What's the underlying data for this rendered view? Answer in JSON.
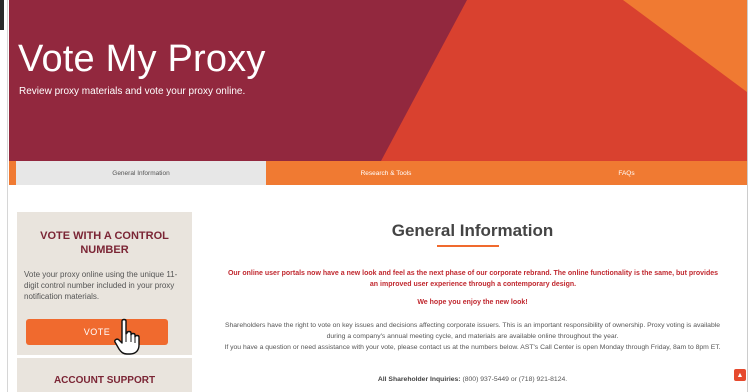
{
  "hero": {
    "title": "Vote My Proxy",
    "subtitle": "Review proxy materials and vote your proxy online."
  },
  "tabs": [
    {
      "label": "General Information",
      "active": true
    },
    {
      "label": "Research & Tools",
      "active": false
    },
    {
      "label": "FAQs",
      "active": false
    }
  ],
  "sidebar": {
    "vote_title": "VOTE WITH A CONTROL NUMBER",
    "vote_text": "Vote your proxy online using the unique 11-digit control number included in your proxy notification materials.",
    "vote_button": "VOTE",
    "account_title": "ACCOUNT SUPPORT"
  },
  "main": {
    "title": "General Information",
    "notice": "Our online user portals now have a new look and feel as the next phase of our corporate rebrand. The online functionality is the same, but provides an improved user experience through a contemporary design.",
    "notice_2": "We hope you enjoy the new look!",
    "paragraph_1": "Shareholders have the right to vote on key issues and decisions affecting corporate issuers. This is an important responsibility of ownership. Proxy voting is available during a company's annual meeting cycle, and materials are available online throughout the year.",
    "paragraph_2": "If you have a question or need assistance with your vote, please contact us at the numbers below. AST's Call Center is open Monday through Friday, 8am to 8pm ET.",
    "contact_label": "All Shareholder Inquiries:",
    "contact_numbers": "(800) 937-5449 or (718) 921-8124."
  },
  "icons": {
    "hand_cursor": "hand-pointer-icon",
    "scroll_top": "chevron-up-icon"
  },
  "colors": {
    "hero_bg": "#92283e",
    "accent_orange": "#f07a32",
    "accent_red": "#d9412f",
    "notice_red": "#c0282f",
    "sidebar_bg": "#e9e4dd"
  }
}
